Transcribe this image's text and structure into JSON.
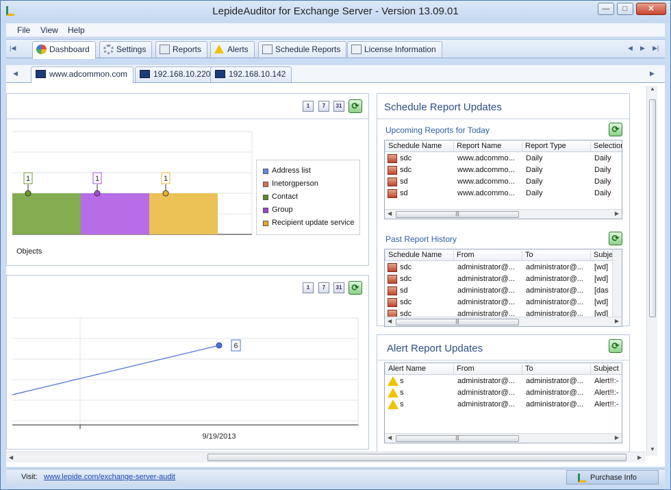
{
  "window": {
    "title": "LepideAuditor for Exchange Server - Version 13.09.01"
  },
  "menu": [
    "File",
    "View",
    "Help"
  ],
  "main_tabs": [
    {
      "label": "Dashboard",
      "icon": "dashboard-icon",
      "active": true
    },
    {
      "label": "Settings",
      "icon": "gear-icon"
    },
    {
      "label": "Reports",
      "icon": "report-icon"
    },
    {
      "label": "Alerts",
      "icon": "warning-icon"
    },
    {
      "label": "Schedule Reports",
      "icon": "schedule-icon"
    },
    {
      "label": "License Information",
      "icon": "license-icon"
    }
  ],
  "server_tabs": [
    {
      "label": "www.adcommon.com",
      "active": true
    },
    {
      "label": "192.168.10.220"
    },
    {
      "label": "192.168.10.142"
    }
  ],
  "calendar_buttons": [
    "1",
    "7",
    "31"
  ],
  "bar_panel": {
    "xlabel": "Objects",
    "chart_data": {
      "type": "bar",
      "categories": [
        "Contact",
        "Group",
        "Recipient update service"
      ],
      "values": [
        1,
        1,
        1
      ],
      "colors": [
        "#6a9a2a",
        "#a64de0",
        "#e8b430"
      ],
      "legend": [
        "Address list",
        "Inetorgperson",
        "Contact",
        "Group",
        "Recipient update service"
      ],
      "legend_colors": [
        "#5b8ee8",
        "#e06b4e",
        "#5b8a2a",
        "#9b3fd6",
        "#e6a820"
      ],
      "legend_position": "right",
      "grid": true
    }
  },
  "line_panel": {
    "chart_data": {
      "type": "line",
      "x": [
        "9/19/2013"
      ],
      "values": [
        6
      ],
      "color": "#4a6fd6",
      "grid": true
    }
  },
  "schedule": {
    "title": "Schedule Report Updates",
    "upcoming": {
      "title": "Upcoming Reports for Today",
      "columns": [
        "Schedule Name",
        "Report Name",
        "Report Type",
        "Selection"
      ],
      "rows": [
        [
          "sdc",
          "www.adcommo...",
          "Daily",
          "Daily"
        ],
        [
          "sdc",
          "www.adcommo...",
          "Daily",
          "Daily"
        ],
        [
          "sd",
          "www.adcommo...",
          "Daily",
          "Daily"
        ],
        [
          "sd",
          "www.adcommo...",
          "Daily",
          "Daily"
        ]
      ]
    },
    "past": {
      "title": "Past Report History",
      "columns": [
        "Schedule Name",
        "From",
        "To",
        "Subje"
      ],
      "rows": [
        [
          "sdc",
          "administrator@...",
          "administrator@...",
          "[wd]"
        ],
        [
          "sdc",
          "administrator@...",
          "administrator@...",
          "[wd]"
        ],
        [
          "sd",
          "administrator@...",
          "administrator@...",
          "[das"
        ],
        [
          "sdc",
          "administrator@...",
          "administrator@...",
          "[wd]"
        ],
        [
          "sdc",
          "administrator@...",
          "administrator@...",
          "[wd]"
        ]
      ]
    }
  },
  "alerts": {
    "title": "Alert Report Updates",
    "columns": [
      "Alert Name",
      "From",
      "To",
      "Subject"
    ],
    "rows": [
      [
        "s",
        "administrator@...",
        "administrator@...",
        "Alert!!:-"
      ],
      [
        "s",
        "administrator@...",
        "administrator@...",
        "Alert!!:-"
      ],
      [
        "s",
        "administrator@...",
        "administrator@...",
        "Alert!!:-"
      ]
    ]
  },
  "status": {
    "visit_label": "Visit:",
    "link": "www.lepide.com/exchange-server-audit",
    "purchase": "Purchase Info"
  }
}
